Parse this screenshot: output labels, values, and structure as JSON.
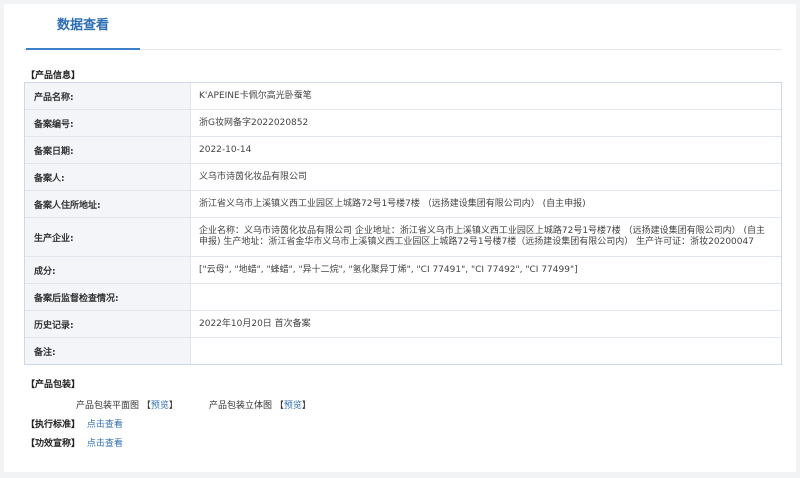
{
  "tabs": {
    "active": "数据查看"
  },
  "info": {
    "section_title": "【产品信息】",
    "rows": [
      {
        "label": "产品名称:",
        "value": "K'APEINE卡佩尔高光卧蚕笔"
      },
      {
        "label": "备案编号:",
        "value": "浙G妆网备字2022020852"
      },
      {
        "label": "备案日期:",
        "value": "2022-10-14"
      },
      {
        "label": "备案人:",
        "value": "义乌市诗茵化妆品有限公司"
      },
      {
        "label": "备案人住所地址:",
        "value": "浙江省义乌市上溪镇义西工业园区上城路72号1号楼7楼 （远扬建设集团有限公司内）  (自主申报)"
      },
      {
        "label": "生产企业:",
        "value": "企业名称：义乌市诗茵化妆品有限公司 企业地址：浙江省义乌市上溪镇义西工业园区上城路72号1号楼7楼 （远扬建设集团有限公司内） (自主申报)   生产地址：浙江省金华市义乌市上溪镇义西工业园区上城路72号1号楼7楼（远扬建设集团有限公司内）  生产许可证：浙妆20200047"
      },
      {
        "label": "成分:",
        "value": "[\"云母\", \"地蜡\", \"蜂蜡\", \"异十二烷\", \"氢化聚异丁烯\", \"CI 77491\", \"CI 77492\", \"CI 77499\"]"
      },
      {
        "label": "备案后监督检查情况:",
        "value": ""
      },
      {
        "label": "历史记录:",
        "value": "2022年10月20日 首次备案"
      },
      {
        "label": "备注:",
        "value": ""
      }
    ]
  },
  "packaging": {
    "section_title": "【产品包装】",
    "flat_label": "产品包装平面图",
    "solid_label": "产品包装立体图",
    "bracket_open": "【",
    "bracket_close": "】",
    "preview_link": "预览"
  },
  "standard": {
    "section_title": "【执行标准】",
    "link": "点击查看"
  },
  "claims": {
    "section_title": "【功效宣称】",
    "link": "点击查看"
  }
}
